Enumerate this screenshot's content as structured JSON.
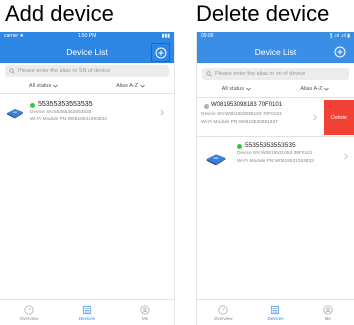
{
  "captions": {
    "left": "Add device",
    "right": "Delete device"
  },
  "left_screen": {
    "status": {
      "carrier": "carrier ★",
      "time": "1:50 PM",
      "battery": "▮▮▮"
    },
    "title": "Device List",
    "search_placeholder": "Please enter the alias or SN of device",
    "filters": {
      "status": "All status",
      "sort": "Alias A-Z"
    },
    "items": [
      {
        "sn": "55355353553535",
        "device_sn": "Device SN:55355353553535",
        "wifi_pn": "Wi-Fi Module PN:W0819531053833",
        "status_color": "#2ecc40"
      }
    ],
    "tabs": [
      {
        "label": "Overview"
      },
      {
        "label": "Devices"
      },
      {
        "label": "Me"
      }
    ]
  },
  "right_screen": {
    "status": {
      "time": "09:06",
      "signal": "℥ .ııl .ııl ▮"
    },
    "title": "Device List",
    "search_placeholder": "Please enter the alias or sn of device",
    "filters": {
      "status": "All status",
      "sort": "Alias A-Z"
    },
    "items": [
      {
        "sn": "W081953098183 70F0101",
        "device_sn": "Device SN:W081953098183 70F0101",
        "wifi_pn": "Wi-Fi Module PN:W0819530981837",
        "status_color": "#b0b0b0"
      },
      {
        "sn": "55355353553535",
        "device_sn": "Device SN:W0819531053 38F0101",
        "wifi_pn": "Wi-Fi Module PN:W0819531053833",
        "status_color": "#2ecc40"
      }
    ],
    "delete_label": "Delete",
    "tabs": [
      {
        "label": "Overview"
      },
      {
        "label": "Devices"
      },
      {
        "label": "Me"
      }
    ]
  },
  "colors": {
    "header_blue": "#2e86e4",
    "delete_red": "#f04134",
    "online_green": "#2ecc40",
    "highlight_red": "#d9262c"
  }
}
